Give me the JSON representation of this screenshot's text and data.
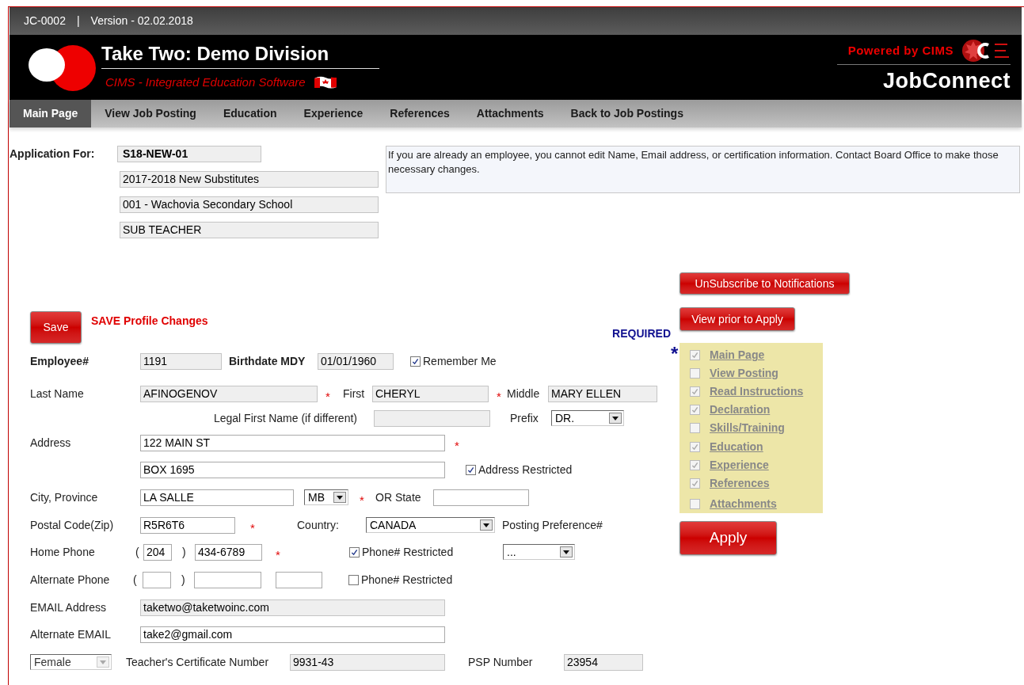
{
  "header": {
    "code": "JC-0002",
    "separator": "|",
    "version": "Version - 02.02.2018",
    "title": "Take Two: Demo Division",
    "subtitle": "CIMS - Integrated Education Software",
    "powered_by": "Powered by CIMS",
    "product": "JobConnect"
  },
  "tabs": [
    {
      "label": "Main Page",
      "selected": true
    },
    {
      "label": "View Job Posting",
      "selected": false
    },
    {
      "label": "Education",
      "selected": false
    },
    {
      "label": "Experience",
      "selected": false
    },
    {
      "label": "References",
      "selected": false
    },
    {
      "label": "Attachments",
      "selected": false
    },
    {
      "label": "Back to Job Postings",
      "selected": false
    }
  ],
  "application": {
    "label": "Application For:",
    "code": "S18-NEW-01",
    "lines": [
      "2017-2018 New Substitutes",
      "001 - Wachovia Secondary School",
      "SUB TEACHER"
    ]
  },
  "notice": "If you are already an employee, you cannot edit Name, Email address, or certification information. Contact Board Office to make those necessary changes.",
  "save": {
    "button": "Save",
    "label": "SAVE Profile Changes"
  },
  "required": {
    "label": "REQUIRED",
    "mark": "*"
  },
  "form": {
    "employee": {
      "label": "Employee#",
      "value": "1191",
      "disabled": true
    },
    "birthdate": {
      "label": "Birthdate MDY",
      "value": "01/01/1960",
      "disabled": true
    },
    "remember": {
      "label": "Remember Me",
      "checked": true
    },
    "last_name": {
      "label": "Last Name",
      "value": "AFINOGENOV",
      "mark": "*",
      "disabled": true
    },
    "first": {
      "label": "First",
      "value": "CHERYL",
      "mark": "*",
      "disabled": true
    },
    "middle": {
      "label": "Middle",
      "value": "MARY ELLEN",
      "disabled": true
    },
    "legal_first": {
      "label": "Legal First Name (if different)",
      "disabled": true
    },
    "prefix": {
      "label": "Prefix",
      "value": "DR."
    },
    "address": {
      "label": "Address",
      "line1": "122 MAIN ST",
      "mark": "*",
      "line2": "BOX 1695",
      "disabled": false
    },
    "address_restricted": {
      "label": "Address Restricted",
      "checked": true
    },
    "city": {
      "label": "City, Province",
      "value": "LA SALLE",
      "province": "MB",
      "mark": "*",
      "disabled": false
    },
    "state": {
      "label": "OR State",
      "disabled": false
    },
    "postal": {
      "label": "Postal Code(Zip)",
      "value": "R5R6T6",
      "mark": "*",
      "disabled": false
    },
    "country": {
      "label": "Country:",
      "value": "CANADA"
    },
    "posting_preference": {
      "label": "Posting Preference#",
      "value": "..."
    },
    "home_phone": {
      "label": "Home Phone",
      "open": "(",
      "area": "204",
      "close": ")",
      "number": "434-6789",
      "mark": "*",
      "disabled": false
    },
    "home_restricted": {
      "label": "Phone# Restricted",
      "checked": true
    },
    "alt_phone": {
      "label": "Alternate Phone",
      "open": "(",
      "close": ")",
      "disabled": false
    },
    "alt_restricted": {
      "label": "Phone# Restricted",
      "checked": false
    },
    "email": {
      "label": "EMAIL Address",
      "value": "taketwo@taketwoinc.com",
      "disabled": true
    },
    "alt_email": {
      "label": "Alternate EMAIL",
      "value": "take2@gmail.com",
      "disabled": false
    },
    "gender": {
      "value": "Female",
      "disabled": true
    },
    "certificate": {
      "label": "Teacher's Certificate Number",
      "value": "9931-43",
      "disabled": true
    },
    "psp": {
      "label": "PSP Number",
      "value": "23954",
      "disabled": true
    }
  },
  "actions": {
    "unsubscribe": "UnSubscribe to Notifications",
    "view_prior": "View prior to Apply",
    "apply": "Apply"
  },
  "checklist": [
    {
      "label": "Main Page",
      "checked": true
    },
    {
      "label": "View Posting",
      "checked": false
    },
    {
      "label": "Read Instructions",
      "checked": true
    },
    {
      "label": "Declaration",
      "checked": true
    },
    {
      "label": "Skills/Training",
      "checked": false
    },
    {
      "label": "Education",
      "checked": true
    },
    {
      "label": "Experience",
      "checked": true
    },
    {
      "label": "References",
      "checked": true
    },
    {
      "label": "Attachments",
      "checked": false
    }
  ]
}
